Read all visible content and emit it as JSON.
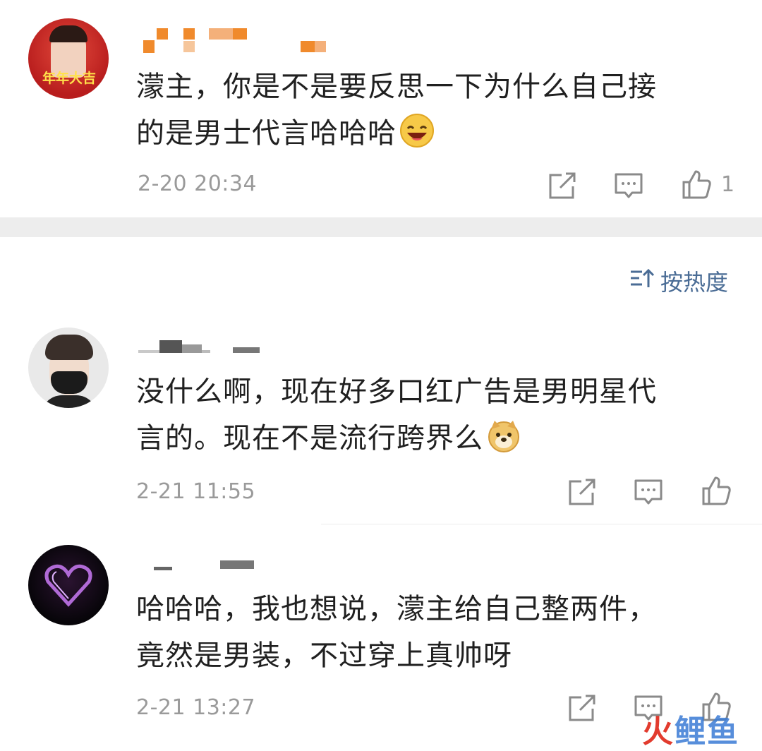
{
  "comments": [
    {
      "avatar_label": "年年大吉",
      "text_line1": "濛主，你是不是要反思一下为什么自己接",
      "text_line2": "的是男士代言哈哈哈",
      "emoji": "laughing-emoji",
      "time": "2-20 20:34",
      "like_count": "1"
    },
    {
      "text_line1": "没什么啊，现在好多口红广告是男明星代",
      "text_line2": "言的。现在不是流行跨界么",
      "emoji": "doge-emoji",
      "time": "2-21 11:55"
    },
    {
      "text_line1": "哈哈哈，我也想说，濛主给自己整两件，",
      "text_line2": "竟然是男装，不过穿上真帅呀",
      "time": "2-21 13:27"
    }
  ],
  "sort": {
    "label": "按热度",
    "icon": "sort-icon"
  },
  "watermark": {
    "text_a": "火",
    "text_b": "鲤鱼"
  },
  "colors": {
    "accent": "#4a6c95",
    "mosaic": "#f08a2c",
    "watermark_red": "#e23b2e",
    "watermark_blue": "#3a7bd5"
  }
}
